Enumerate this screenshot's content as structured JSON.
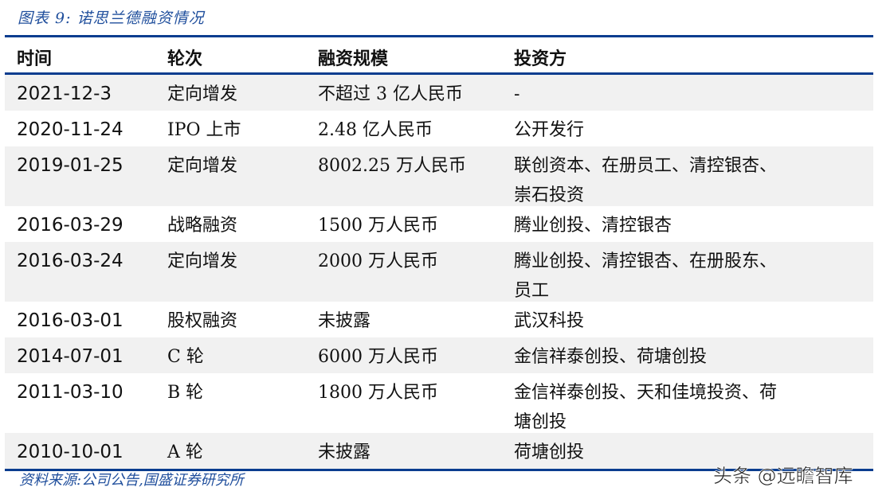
{
  "caption": "图表 9:  诺思兰德融资情况",
  "table": {
    "columns": [
      "时间",
      "轮次",
      "融资规模",
      "投资方"
    ],
    "rows": [
      {
        "date": "2021-12-3",
        "round": "定向增发",
        "amount": "不超过 3 亿人民币",
        "investors": [
          "-"
        ]
      },
      {
        "date": "2020-11-24",
        "round": "IPO 上市",
        "amount": "2.48 亿人民币",
        "investors": [
          "公开发行"
        ]
      },
      {
        "date": "2019-01-25",
        "round": "定向增发",
        "amount": "8002.25 万人民币",
        "investors": [
          "联创资本、在册员工、清控银杏、",
          "崇石投资"
        ]
      },
      {
        "date": "2016-03-29",
        "round": "战略融资",
        "amount": "1500 万人民币",
        "investors": [
          "腾业创投、清控银杏"
        ]
      },
      {
        "date": "2016-03-24",
        "round": "定向增发",
        "amount": "2000 万人民币",
        "investors": [
          "腾业创投、清控银杏、在册股东、",
          "员工"
        ]
      },
      {
        "date": "2016-03-01",
        "round": "股权融资",
        "amount": "未披露",
        "investors": [
          "武汉科投"
        ]
      },
      {
        "date": "2014-07-01",
        "round": "C 轮",
        "amount": "6000 万人民币",
        "investors": [
          "金信祥泰创投、荷塘创投"
        ]
      },
      {
        "date": "2011-03-10",
        "round": "B 轮",
        "amount": "1800 万人民币",
        "investors": [
          "金信祥泰创投、天和佳境投资、荷",
          "塘创投"
        ]
      },
      {
        "date": "2010-10-01",
        "round": "A 轮",
        "amount": "未披露",
        "investors": [
          "荷塘创投"
        ]
      }
    ]
  },
  "source": "资料来源:公司公告,国盛证券研究所",
  "watermark": "头条 @远瞻智库",
  "colors": {
    "rule": "#0a3d8f",
    "caption": "#1f4e9c",
    "row_alt": "#f1f1f1"
  }
}
